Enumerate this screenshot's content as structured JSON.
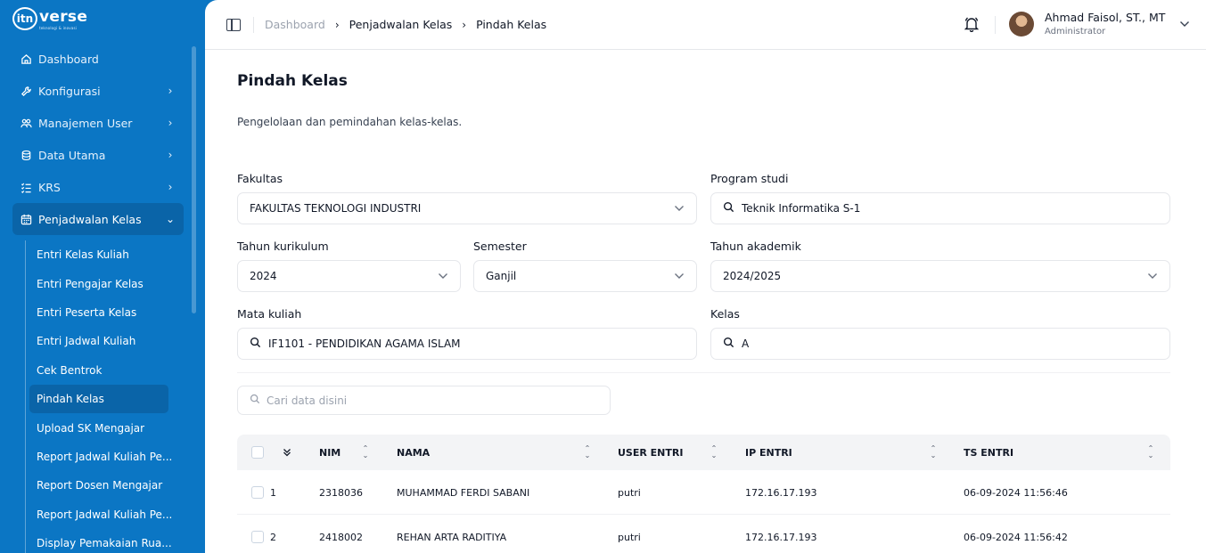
{
  "app": {
    "logo_text": "verse",
    "logo_mark": "itn",
    "logo_sub": "teknologi & inovasi"
  },
  "sidebar": {
    "items": [
      {
        "label": "Dashboard",
        "icon": "home-icon"
      },
      {
        "label": "Konfigurasi",
        "icon": "wrench-icon"
      },
      {
        "label": "Manajemen User",
        "icon": "users-icon"
      },
      {
        "label": "Data Utama",
        "icon": "database-icon"
      },
      {
        "label": "KRS",
        "icon": "list-check-icon"
      },
      {
        "label": "Penjadwalan Kelas",
        "icon": "calendar-icon"
      }
    ],
    "subitems": [
      "Entri Kelas Kuliah",
      "Entri Pengajar Kelas",
      "Entri Peserta Kelas",
      "Entri Jadwal Kuliah",
      "Cek Bentrok",
      "Pindah Kelas",
      "Upload SK Mengajar",
      "Report Jadwal Kuliah Pe...",
      "Report Dosen Mengajar",
      "Report Jadwal Kuliah Pe...",
      "Display Pemakaian Rua..."
    ]
  },
  "header": {
    "breadcrumb": [
      "Dashboard",
      "Penjadwalan Kelas",
      "Pindah Kelas"
    ],
    "user_name": "Ahmad Faisol, ST., MT",
    "user_role": "Administrator"
  },
  "page": {
    "title": "Pindah Kelas",
    "description": "Pengelolaan dan pemindahan kelas-kelas."
  },
  "filters": {
    "fakultas": {
      "label": "Fakultas",
      "value": "FAKULTAS TEKNOLOGI INDUSTRI"
    },
    "prodi": {
      "label": "Program studi",
      "value": "Teknik Informatika S-1"
    },
    "kurikulum": {
      "label": "Tahun kurikulum",
      "value": "2024"
    },
    "semester": {
      "label": "Semester",
      "value": "Ganjil"
    },
    "akademik": {
      "label": "Tahun akademik",
      "value": "2024/2025"
    },
    "matkul": {
      "label": "Mata kuliah",
      "value": "IF1101 - PENDIDIKAN AGAMA ISLAM"
    },
    "kelas": {
      "label": "Kelas",
      "value": "A"
    }
  },
  "search": {
    "placeholder": "Cari data disini"
  },
  "table": {
    "columns": [
      "NIM",
      "NAMA",
      "USER ENTRI",
      "IP ENTRI",
      "TS ENTRI"
    ],
    "rows": [
      {
        "no": "1",
        "nim": "2318036",
        "nama": "MUHAMMAD FERDI SABANI",
        "user": "putri",
        "ip": "172.16.17.193",
        "ts": "06-09-2024 11:56:46"
      },
      {
        "no": "2",
        "nim": "2418002",
        "nama": "REHAN ARTA RADITIYA",
        "user": "putri",
        "ip": "172.16.17.193",
        "ts": "06-09-2024 11:56:42"
      }
    ]
  }
}
